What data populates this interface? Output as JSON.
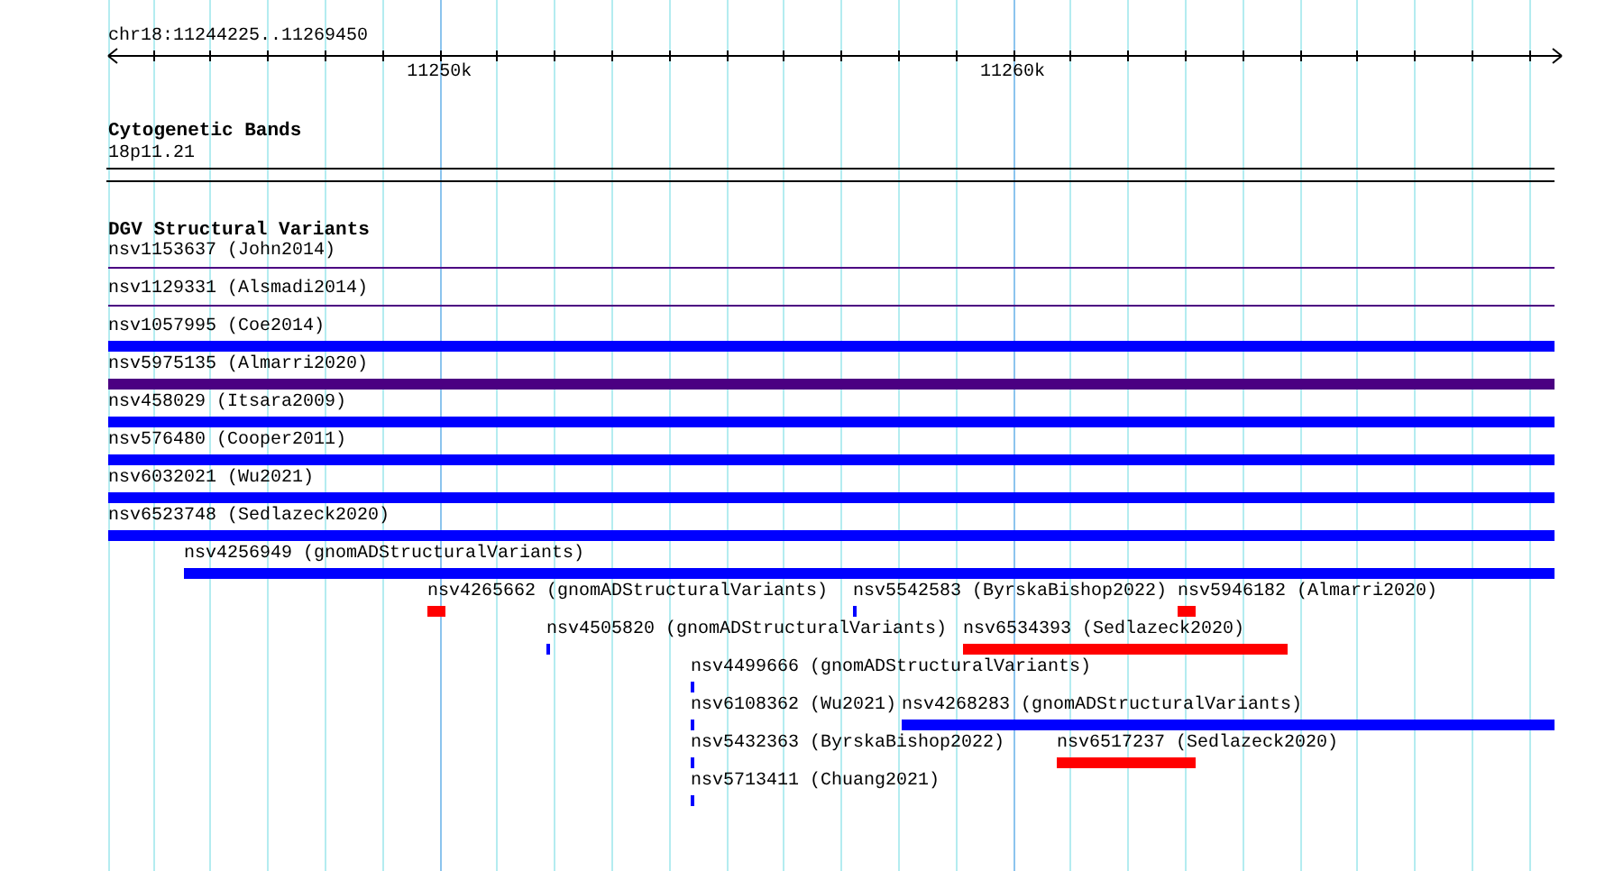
{
  "ruler": {
    "location": "chr18:11244225..11269450",
    "ticks": [
      "11250k",
      "11260k"
    ]
  },
  "tracks": [
    {
      "title": "Cytogenetic Bands",
      "features": [
        {
          "label": "18p11.21",
          "kind": "band",
          "color": "#000000"
        }
      ]
    },
    {
      "title": "DGV Structural Variants",
      "features": [
        {
          "label": "nsv1153637 (John2014)",
          "kind": "line",
          "color": "#4b0082"
        },
        {
          "label": "nsv1129331 (Alsmadi2014)",
          "kind": "line",
          "color": "#4b0082"
        },
        {
          "label": "nsv1057995 (Coe2014)",
          "kind": "bar",
          "color": "#0000ff"
        },
        {
          "label": "nsv5975135 (Almarri2020)",
          "kind": "bar",
          "color": "#4b0082"
        },
        {
          "label": "nsv458029 (Itsara2009)",
          "kind": "bar",
          "color": "#0000ff"
        },
        {
          "label": "nsv576480 (Cooper2011)",
          "kind": "bar",
          "color": "#0000ff"
        },
        {
          "label": "nsv6032021 (Wu2021)",
          "kind": "bar",
          "color": "#0000ff"
        },
        {
          "label": "nsv6523748 (Sedlazeck2020)",
          "kind": "bar",
          "color": "#0000ff"
        },
        {
          "label": "nsv4256949 (gnomADStructuralVariants)",
          "kind": "bar",
          "color": "#0000ff"
        },
        {
          "label": "nsv4265662 (gnomADStructuralVariants)",
          "kind": "bar",
          "color": "#ff0000"
        },
        {
          "label": "nsv5542583 (ByrskaBishop2022)",
          "kind": "bar",
          "color": "#0000ff"
        },
        {
          "label": "nsv5946182 (Almarri2020)",
          "kind": "bar",
          "color": "#ff0000"
        },
        {
          "label": "nsv4505820 (gnomADStructuralVariants)",
          "kind": "bar",
          "color": "#0000ff"
        },
        {
          "label": "nsv6534393 (Sedlazeck2020)",
          "kind": "bar",
          "color": "#ff0000"
        },
        {
          "label": "nsv4499666 (gnomADStructuralVariants)",
          "kind": "bar",
          "color": "#0000ff"
        },
        {
          "label": "nsv6108362 (Wu2021)",
          "kind": "bar",
          "color": "#0000ff"
        },
        {
          "label": "nsv4268283 (gnomADStructuralVariants)",
          "kind": "bar",
          "color": "#0000ff"
        },
        {
          "label": "nsv5432363 (ByrskaBishop2022)",
          "kind": "bar",
          "color": "#0000ff"
        },
        {
          "label": "nsv6517237 (Sedlazeck2020)",
          "kind": "bar",
          "color": "#ff0000"
        },
        {
          "label": "nsv5713411 (Chuang2021)",
          "kind": "bar",
          "color": "#0000ff"
        }
      ]
    }
  ]
}
